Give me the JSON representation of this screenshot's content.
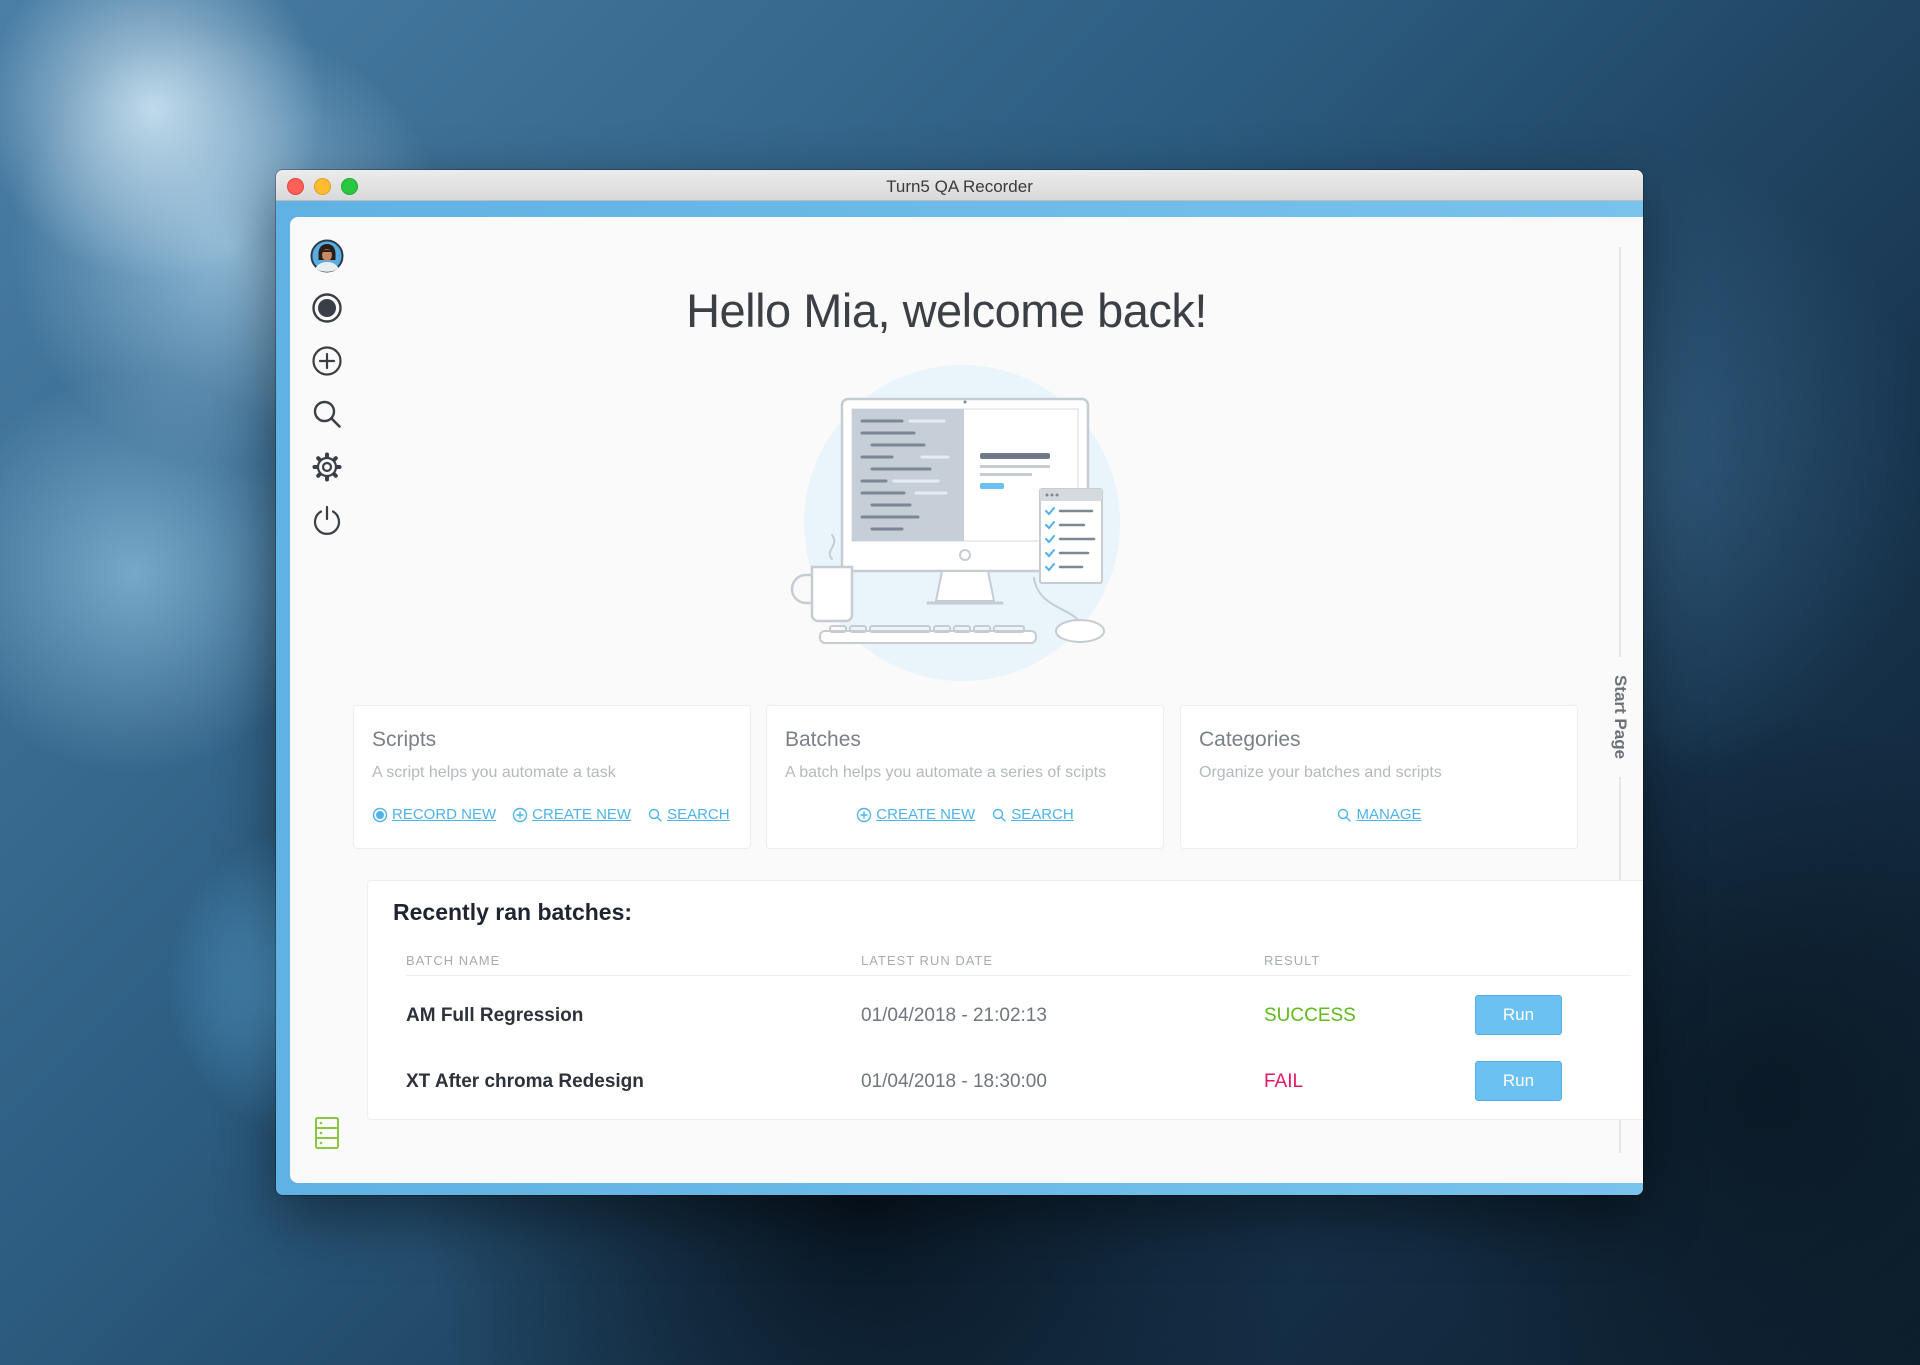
{
  "window": {
    "title": "Turn5 QA Recorder"
  },
  "sidebar": {
    "items": [
      {
        "icon": "avatar"
      },
      {
        "icon": "record-icon"
      },
      {
        "icon": "plus-circle-icon"
      },
      {
        "icon": "search-icon"
      },
      {
        "icon": "gear-icon"
      },
      {
        "icon": "power-icon"
      },
      {
        "icon": "server-icon"
      }
    ]
  },
  "right_rail": {
    "label": "Start Page"
  },
  "greeting": "Hello Mia, welcome back!",
  "cards": [
    {
      "title": "Scripts",
      "description": "A script helps you automate a task",
      "actions": [
        {
          "label": "RECORD NEW",
          "icon": "record-icon"
        },
        {
          "label": "CREATE NEW",
          "icon": "plus-circle-icon"
        },
        {
          "label": "SEARCH",
          "icon": "search-icon"
        }
      ]
    },
    {
      "title": "Batches",
      "description": "A batch helps you automate a series of scipts",
      "actions": [
        {
          "label": "CREATE NEW",
          "icon": "plus-circle-icon"
        },
        {
          "label": "SEARCH",
          "icon": "search-icon"
        }
      ]
    },
    {
      "title": "Categories",
      "description": "Organize your batches and scripts",
      "actions": [
        {
          "label": "MANAGE",
          "icon": "search-icon"
        }
      ]
    }
  ],
  "batches": {
    "title": "Recently ran batches:",
    "columns": [
      "BATCH NAME",
      "LATEST RUN DATE",
      "RESULT"
    ],
    "rows": [
      {
        "name": "AM Full Regression",
        "date": "01/04/2018 - 21:02:13",
        "result": "SUCCESS",
        "result_color": "#5fba1c",
        "run_label": "Run"
      },
      {
        "name": "XT After chroma Redesign",
        "date": "01/04/2018 - 18:30:00",
        "result": "FAIL",
        "result_color": "#e2195a",
        "run_label": "Run"
      }
    ]
  },
  "colors": {
    "accent": "#4fb3ea",
    "run_button": "#6cc1f3",
    "success": "#5fba1c",
    "fail": "#e2195a",
    "server_icon": "#8cc63f"
  }
}
